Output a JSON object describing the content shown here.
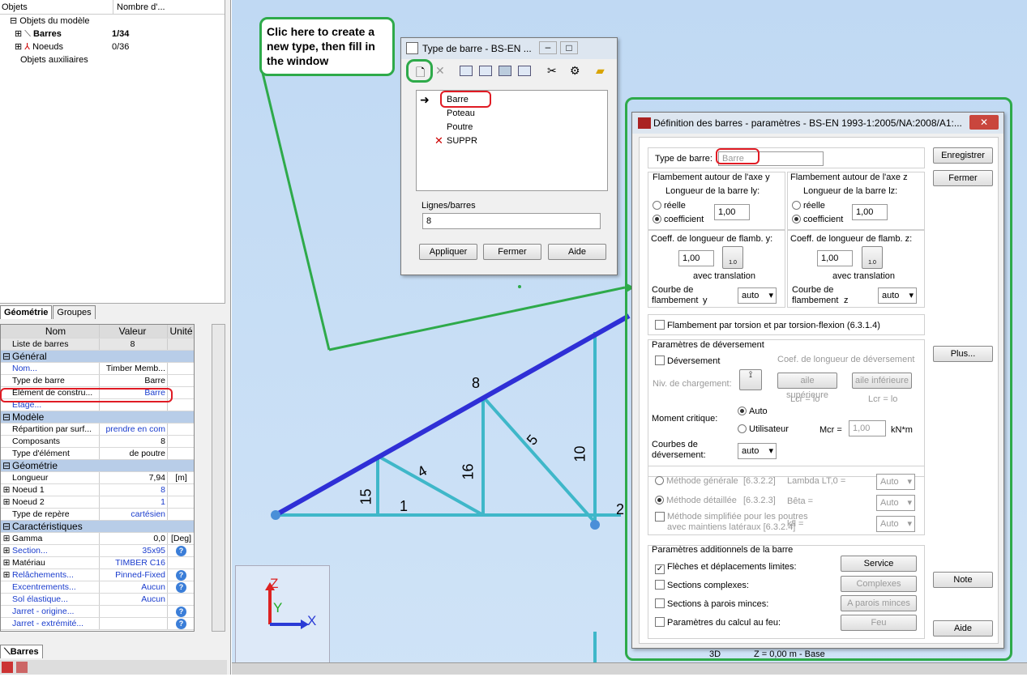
{
  "tree": {
    "col1": "Objets",
    "col2": "Nombre d'...",
    "root": "Objets du modèle",
    "items": [
      {
        "label": "Barres",
        "count": "1/34"
      },
      {
        "label": "Noeuds",
        "count": "0/36"
      }
    ],
    "aux": "Objets auxiliaires"
  },
  "tabs": {
    "geometry": "Géométrie",
    "groups": "Groupes"
  },
  "grid": {
    "h_name": "Nom",
    "h_value": "Valeur",
    "h_unit": "Unité",
    "list": {
      "name": "Liste de barres",
      "value": "8"
    },
    "sec_general": "Général",
    "nom": {
      "name": "Nom...",
      "value": "Timber Memb..."
    },
    "type": {
      "name": "Type de barre",
      "value": "Barre"
    },
    "element": {
      "name": "Elément de constru...",
      "value": "Barre"
    },
    "etage": {
      "name": "Etage...",
      "value": ""
    },
    "sec_model": "Modèle",
    "repart": {
      "name": "Répartition par surf...",
      "value": "prendre en com"
    },
    "comp": {
      "name": "Composants",
      "value": "8"
    },
    "typeel": {
      "name": "Type d'élément",
      "value": "de poutre"
    },
    "sec_geo": "Géométrie",
    "longueur": {
      "name": "Longueur",
      "value": "7,94",
      "unit": "[m]"
    },
    "n1": {
      "name": "Noeud 1",
      "value": "8"
    },
    "n2": {
      "name": "Noeud 2",
      "value": "1"
    },
    "repere": {
      "name": "Type de repère",
      "value": "cartésien"
    },
    "sec_car": "Caractéristiques",
    "gamma": {
      "name": "Gamma",
      "value": "0,0",
      "unit": "[Deg]"
    },
    "section": {
      "name": "Section...",
      "value": "35x95"
    },
    "mat": {
      "name": "Matériau",
      "value": "TIMBER C16"
    },
    "rel": {
      "name": "Relâchements...",
      "value": "Pinned-Fixed"
    },
    "exc": {
      "name": "Excentrements...",
      "value": "Aucun"
    },
    "sol": {
      "name": "Sol élastique...",
      "value": "Aucun"
    },
    "jo": {
      "name": "Jarret - origine...",
      "value": ""
    },
    "je": {
      "name": "Jarret - extrémité...",
      "value": ""
    }
  },
  "btab": "Barres",
  "annotation": "Clic here to create a new type, then fill in the window",
  "view": {
    "labels": [
      "8",
      "5",
      "10",
      "4",
      "16",
      "15",
      "1",
      "2"
    ],
    "axes": {
      "z": "Z",
      "y": "Y",
      "x": "X"
    },
    "status_3d": "3D",
    "status_z": "Z = 0,00 m - Base"
  },
  "type_win": {
    "title": "Type de barre - BS-EN ...",
    "items": [
      "Barre",
      "Poteau",
      "Poutre",
      "SUPPR"
    ],
    "lines_label": "Lignes/barres",
    "lines_value": "8",
    "apply": "Appliquer",
    "close": "Fermer",
    "help": "Aide"
  },
  "def": {
    "title": "Définition des barres - paramètres - BS-EN 1993-1:2005/NA:2008/A1:...",
    "type_label": "Type de barre:",
    "type_value": "Barre",
    "save": "Enregistrer",
    "close": "Fermer",
    "more": "Plus...",
    "note": "Note",
    "help": "Aide",
    "fy_title": "Flambement autour de l'axe y",
    "fz_title": "Flambement autour de l'axe z",
    "ly": "Longueur de la barre ly:",
    "lz": "Longueur de la barre lz:",
    "reelle": "réelle",
    "coef": "coefficient",
    "coef_y": "1,00",
    "coef_z": "1,00",
    "cfy": "Coeff. de longueur de flamb. y:",
    "cfz": "Coeff. de longueur de flamb. z:",
    "cfy_v": "1,00",
    "cfz_v": "1,00",
    "icon_v": "1.0",
    "avec": "avec translation",
    "courbe": "Courbe de flambement",
    "sy": "y",
    "sz": "z",
    "auto": "auto",
    "torsion": "Flambement par torsion et par torsion-flexion (6.3.1.4)",
    "dev_title": "Paramètres de déversement",
    "dev": "Déversement",
    "coef_dev": "Coef. de longueur de déversement",
    "niv": "Niv. de chargement:",
    "sup": "aile supérieure",
    "inf": "aile inférieure",
    "lcr": "Lcr = lo",
    "moment": "Moment critique:",
    "auto_r": "Auto",
    "user_r": "Utilisateur",
    "mcr": "Mcr =",
    "mcr_v": "1,00",
    "knm": "kN*m",
    "courbes_dev": "Courbes de déversement:",
    "mg": "Méthode générale",
    "mg_ref": "[6.3.2.2]",
    "md": "Méthode détaillée",
    "md_ref": "[6.3.2.3]",
    "ms": "Méthode simplifiée pour les poutres avec maintiens latéraux [6.3.2.4]",
    "lambda": "Lambda LT,0 =",
    "beta": "Bêta =",
    "kfl": "kfl =",
    "auto_c": "Auto",
    "add_title": "Paramètres additionnels de la barre",
    "fleches": "Flèches et déplacements limites:",
    "sc": "Sections complexes:",
    "spm": "Sections à parois minces:",
    "feu": "Paramètres du calcul au feu:",
    "service": "Service",
    "complexes": "Complexes",
    "parois": "A parois minces",
    "feu_b": "Feu"
  }
}
